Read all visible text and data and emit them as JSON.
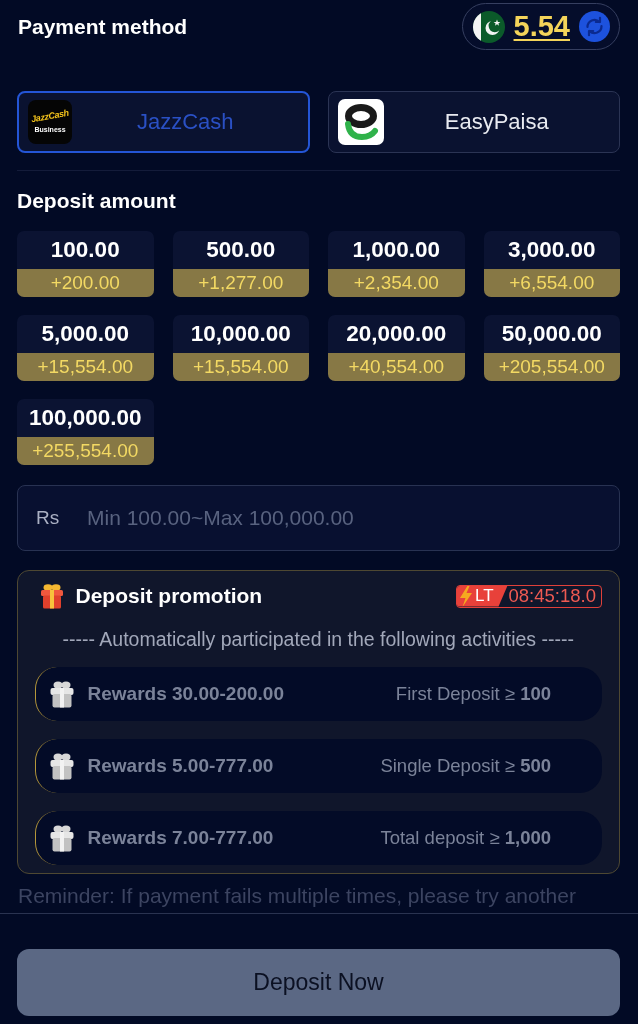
{
  "header": {
    "title": "Payment method",
    "balance": "5.54"
  },
  "payment_methods": [
    {
      "name": "JazzCash",
      "kind": "jazzcash",
      "logo_text": "JazzCash",
      "logo_subtext": "Business",
      "selected": true
    },
    {
      "name": "EasyPaisa",
      "kind": "easypaisa",
      "selected": false
    }
  ],
  "deposit_amount": {
    "title": "Deposit amount",
    "options": [
      {
        "amount": "100.00",
        "bonus": "+200.00"
      },
      {
        "amount": "500.00",
        "bonus": "+1,277.00"
      },
      {
        "amount": "1,000.00",
        "bonus": "+2,354.00"
      },
      {
        "amount": "3,000.00",
        "bonus": "+6,554.00"
      },
      {
        "amount": "5,000.00",
        "bonus": "+15,554.00"
      },
      {
        "amount": "10,000.00",
        "bonus": "+15,554.00"
      },
      {
        "amount": "20,000.00",
        "bonus": "+40,554.00"
      },
      {
        "amount": "50,000.00",
        "bonus": "+205,554.00"
      },
      {
        "amount": "100,000.00",
        "bonus": "+255,554.00"
      }
    ]
  },
  "amount_field": {
    "currency": "Rs",
    "placeholder": "Min 100.00~Max 100,000.00"
  },
  "promotion": {
    "title": "Deposit promotion",
    "timer_label": "LT",
    "timer": "08:45:18.0",
    "subtitle": "----- Automatically participated in the following activities -----",
    "rewards": [
      {
        "reward": "Rewards 30.00-200.00",
        "condition": "First Deposit ≥ **100**"
      },
      {
        "reward": "Rewards 5.00-777.00",
        "condition": "Single Deposit ≥ **500**"
      },
      {
        "reward": "Rewards 7.00-777.00",
        "condition": "Total deposit ≥ **1,000**"
      }
    ]
  },
  "reminder": "Reminder: If payment fails multiple times, please try another",
  "footer": {
    "button": "Deposit Now"
  }
}
